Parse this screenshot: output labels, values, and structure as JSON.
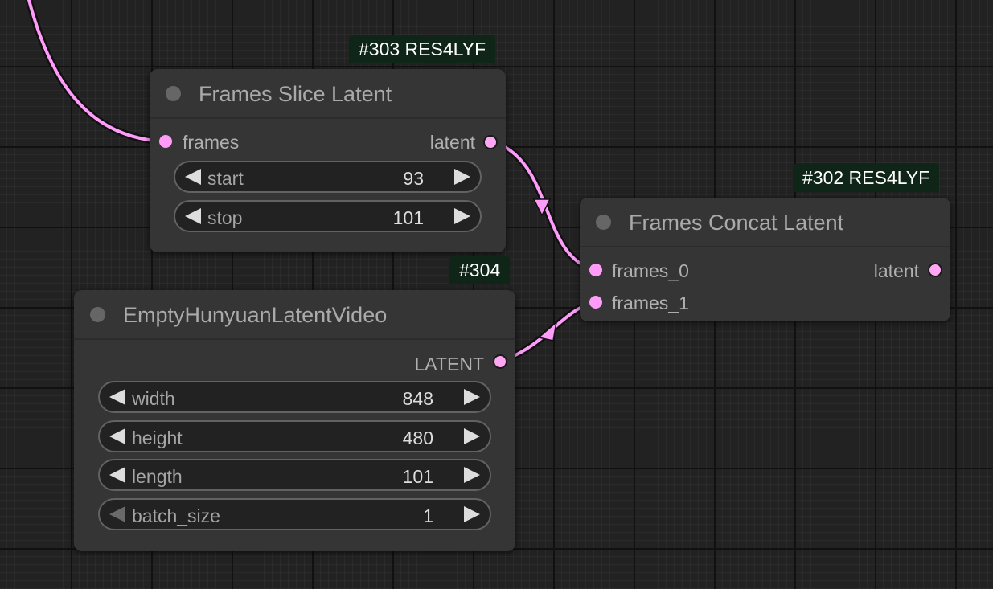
{
  "accent": {
    "link_color": "#ff9cf9",
    "badge_bg": "#0f2518",
    "node_bg": "#353535",
    "canvas_bg": "#222222"
  },
  "nodes": {
    "frames_slice": {
      "badge": "#303 RES4LYF",
      "title": "Frames Slice Latent",
      "inputs": [
        "frames"
      ],
      "outputs": [
        "latent"
      ],
      "widgets": [
        {
          "name": "start",
          "value": "93"
        },
        {
          "name": "stop",
          "value": "101"
        }
      ]
    },
    "frames_concat": {
      "badge": "#302 RES4LYF",
      "title": "Frames Concat Latent",
      "inputs": [
        "frames_0",
        "frames_1"
      ],
      "outputs": [
        "latent"
      ]
    },
    "empty_hunyuan": {
      "badge": "#304",
      "title": "EmptyHunyuanLatentVideo",
      "outputs": [
        "LATENT"
      ],
      "widgets": [
        {
          "name": "width",
          "value": "848"
        },
        {
          "name": "height",
          "value": "480"
        },
        {
          "name": "length",
          "value": "101"
        },
        {
          "name": "batch_size",
          "value": "1"
        }
      ]
    }
  }
}
